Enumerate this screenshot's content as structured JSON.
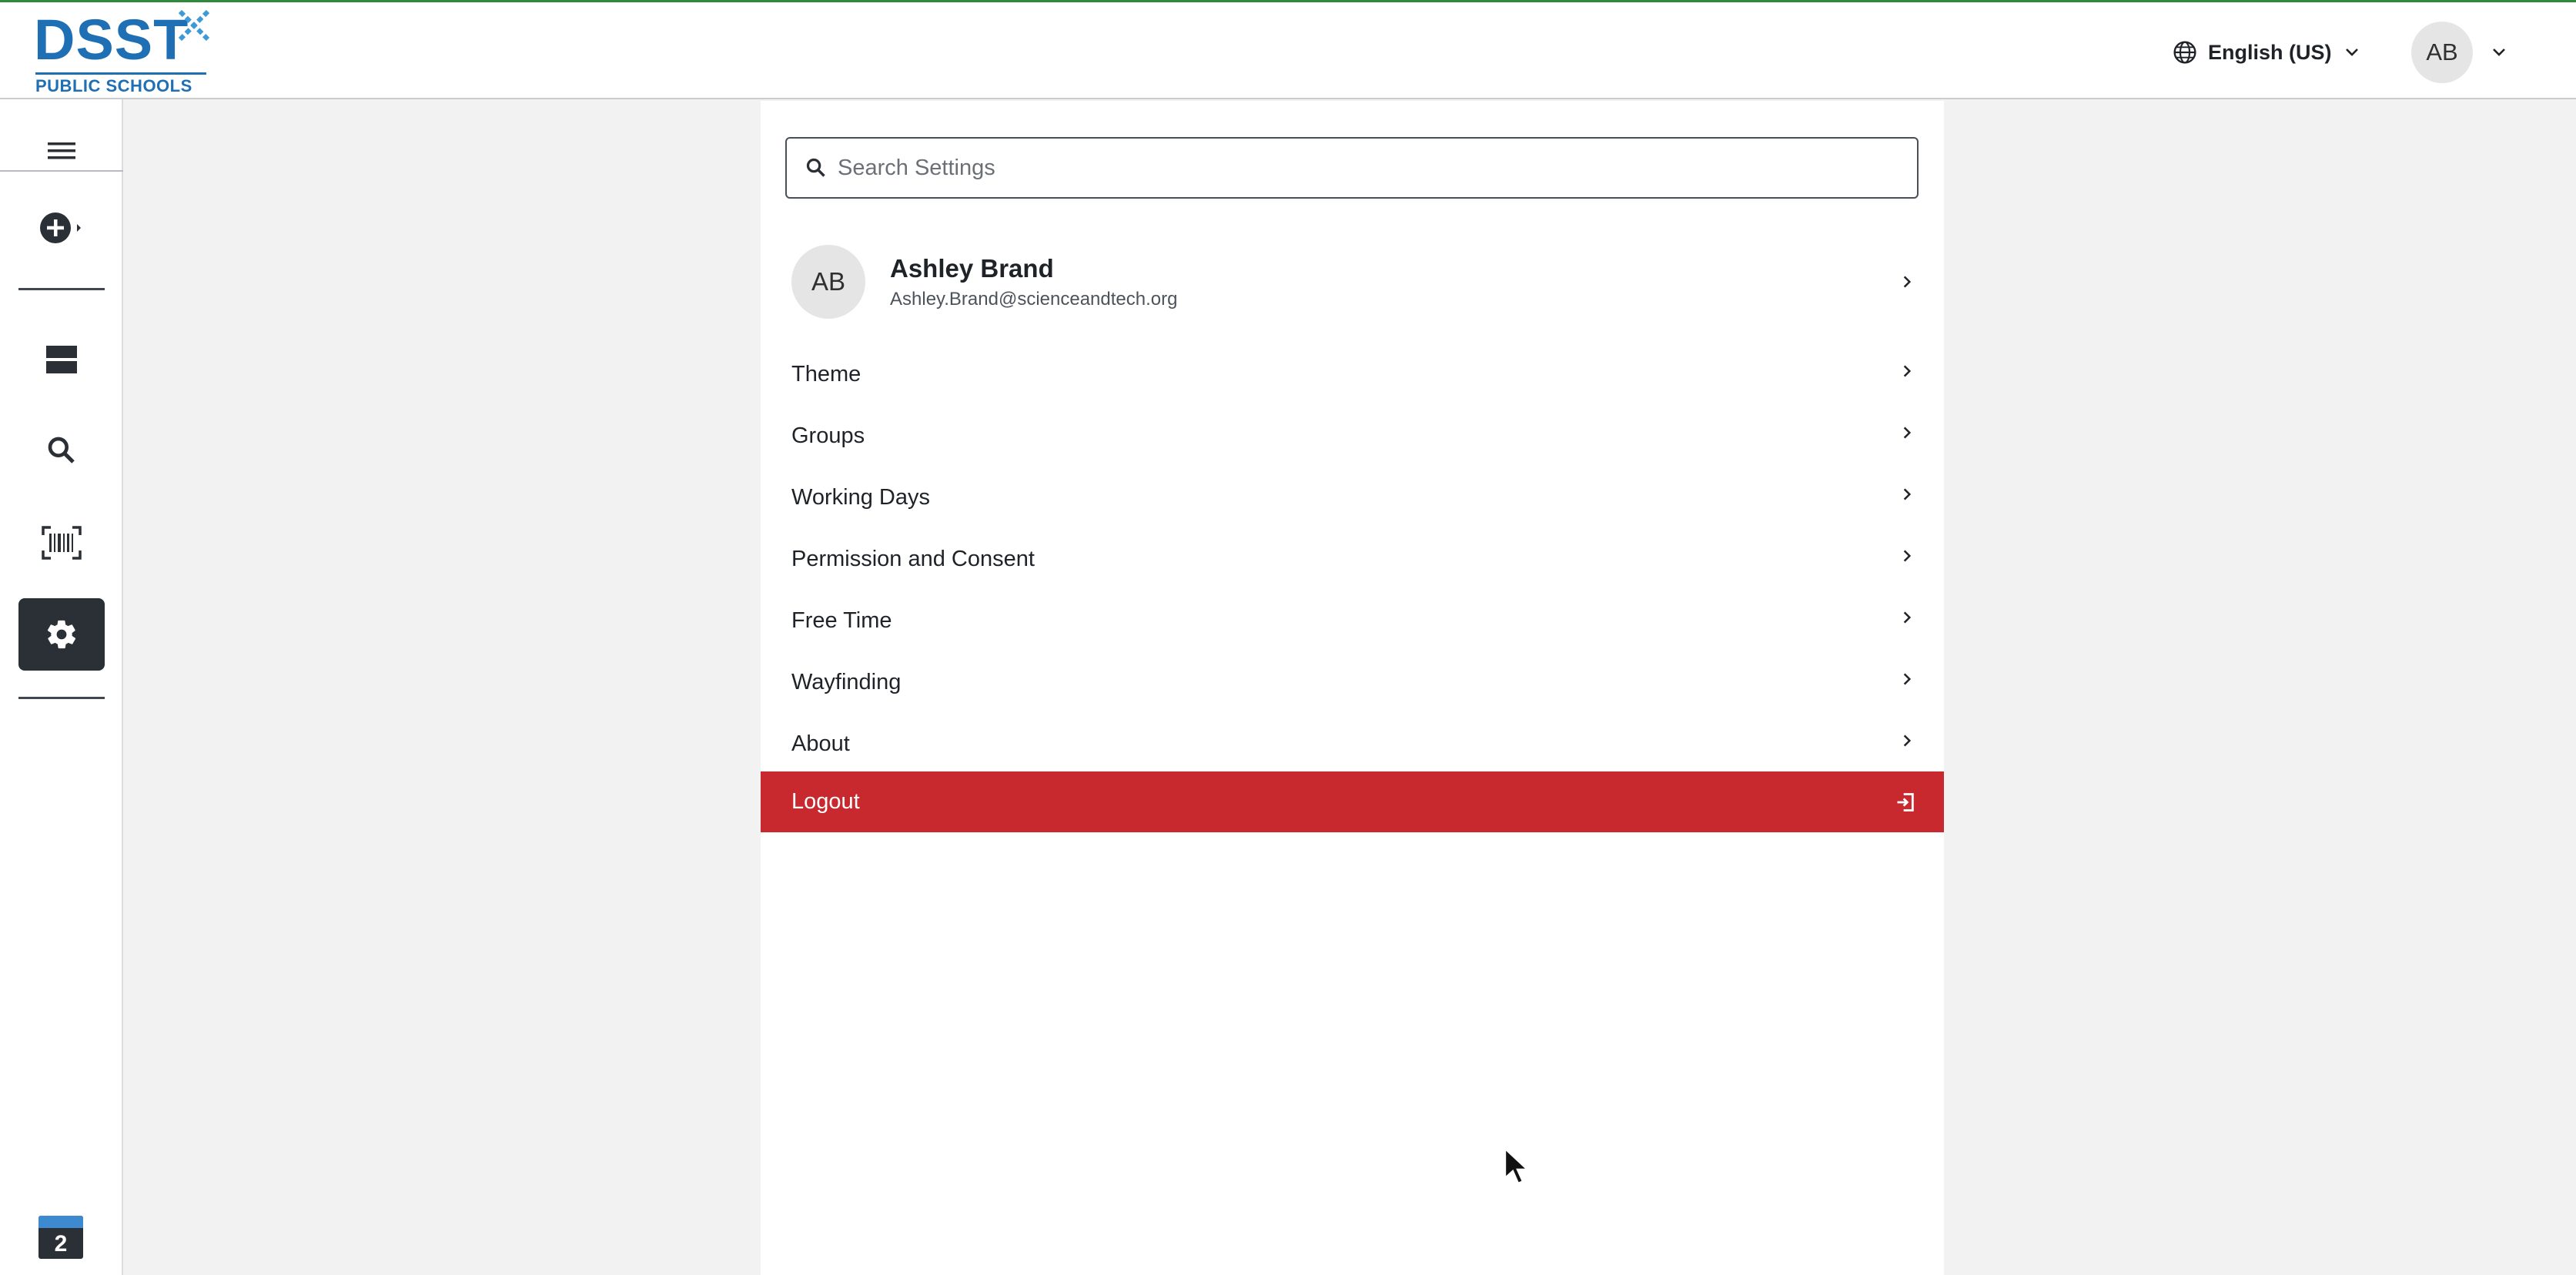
{
  "header": {
    "logo_text": "DSST",
    "logo_sub": "PUBLIC SCHOOLS",
    "language": "English (US)",
    "user_initials": "AB"
  },
  "sidebar": {
    "items": [
      {
        "name": "menu",
        "icon": "hamburger-icon"
      },
      {
        "name": "create",
        "icon": "plus-circle-icon"
      },
      {
        "name": "list",
        "icon": "rows-icon"
      },
      {
        "name": "search",
        "icon": "search-icon"
      },
      {
        "name": "scan",
        "icon": "barcode-icon"
      },
      {
        "name": "settings",
        "icon": "gear-icon",
        "active": true
      }
    ],
    "calendar_day": "2"
  },
  "settings": {
    "search_placeholder": "Search Settings",
    "profile": {
      "initials": "AB",
      "name": "Ashley Brand",
      "email": "Ashley.Brand@scienceandtech.org"
    },
    "menu_items": [
      "Theme",
      "Groups",
      "Working Days",
      "Permission and Consent",
      "Free Time",
      "Wayfinding",
      "About"
    ],
    "logout_label": "Logout"
  },
  "colors": {
    "logo_blue": "#1f6fb5",
    "sidebar_active": "#2b2f36",
    "logout_red": "#c8292f",
    "top_accent": "#2f8a3a"
  }
}
